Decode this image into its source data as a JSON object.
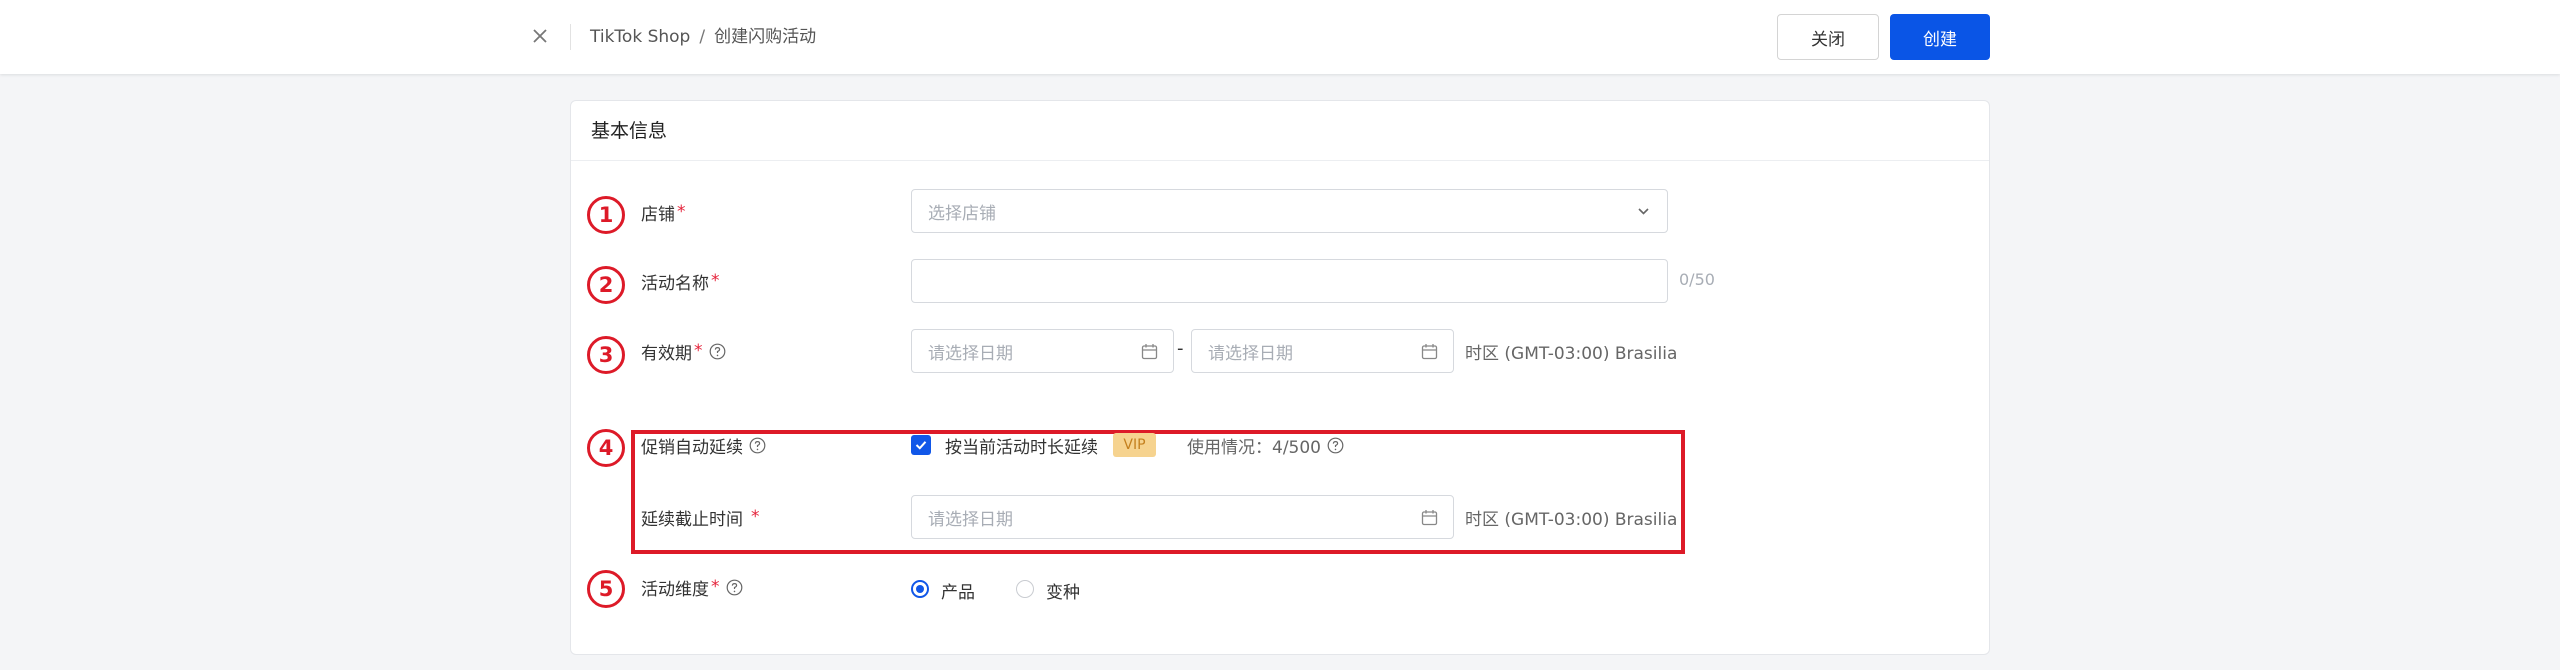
{
  "header": {
    "breadcrumb": {
      "root": "TikTok Shop",
      "separator": "/",
      "current": "创建闪购活动"
    },
    "close_label": "关闭",
    "create_label": "创建"
  },
  "section": {
    "title": "基本信息"
  },
  "annotations": [
    "1",
    "2",
    "3",
    "4",
    "5"
  ],
  "form": {
    "shop": {
      "label": "店铺",
      "required_mark": "*",
      "placeholder": "选择店铺"
    },
    "name": {
      "label": "活动名称",
      "required_mark": "*",
      "value": "",
      "counter": "0/50"
    },
    "validity": {
      "label": "有效期",
      "required_mark": "*",
      "start_placeholder": "请选择日期",
      "separator": "-",
      "end_placeholder": "请选择日期",
      "timezone": "时区 (GMT-03:00) Brasilia"
    },
    "auto_extend": {
      "label": "促销自动延续",
      "checkbox_label": "按当前活动时长延续",
      "checked": true,
      "badge": "VIP",
      "usage": "使用情况：4/500"
    },
    "extend_deadline": {
      "label": "延续截止时间",
      "required_mark": "*",
      "placeholder": "请选择日期",
      "timezone": "时区 (GMT-03:00) Brasilia"
    },
    "dimension": {
      "label": "活动维度",
      "required_mark": "*",
      "options": [
        "产品",
        "变种"
      ],
      "selected": "产品"
    }
  },
  "colors": {
    "primary": "#0a55e6",
    "annotation": "#dd1a28",
    "vip_bg": "#f6d38f",
    "required": "#e5233b"
  }
}
